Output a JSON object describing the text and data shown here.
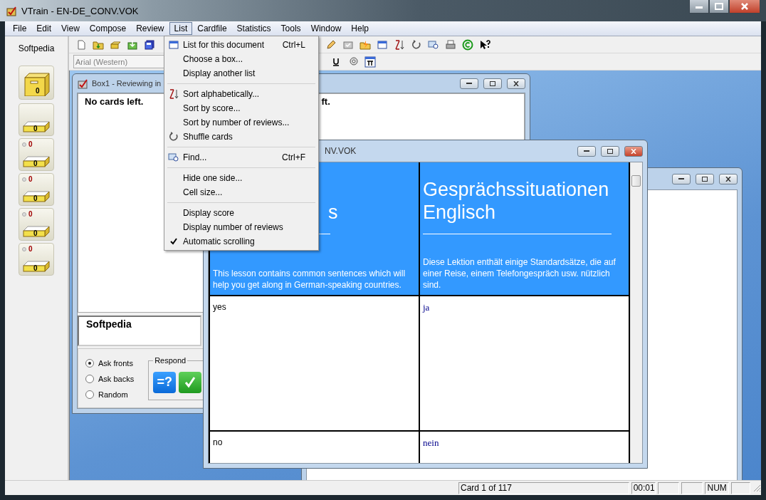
{
  "window": {
    "title": "VTrain - EN-DE_CONV.VOK"
  },
  "menu_bar": [
    {
      "label": "File",
      "selected": false
    },
    {
      "label": "Edit",
      "selected": false
    },
    {
      "label": "View",
      "selected": false
    },
    {
      "label": "Compose",
      "selected": false
    },
    {
      "label": "Review",
      "selected": false
    },
    {
      "label": "List",
      "selected": true
    },
    {
      "label": "Cardfile",
      "selected": false
    },
    {
      "label": "Statistics",
      "selected": false
    },
    {
      "label": "Tools",
      "selected": false
    },
    {
      "label": "Window",
      "selected": false
    },
    {
      "label": "Help",
      "selected": false
    }
  ],
  "sidebar": {
    "label": "Softpedia",
    "boxes": [
      {
        "kind": "drawer",
        "count": "0"
      },
      {
        "kind": "tray",
        "count": "0"
      },
      {
        "kind": "tray",
        "count": "0",
        "due": "0"
      },
      {
        "kind": "tray",
        "count": "0",
        "due": "0"
      },
      {
        "kind": "tray",
        "count": "0",
        "due": "0"
      },
      {
        "kind": "tray",
        "count": "0",
        "due": "0"
      }
    ]
  },
  "toolbar": {
    "font_field": {
      "value": "Arial (Western)",
      "disabled": true
    }
  },
  "box_window": {
    "title": "Box1 - Reviewing in",
    "panes": [
      "No cards left.",
      "ft."
    ],
    "answer": "Softpedia",
    "ask_options": [
      {
        "label": "Ask fronts",
        "selected": true
      },
      {
        "label": "Ask backs",
        "selected": false
      },
      {
        "label": "Random",
        "selected": false
      }
    ],
    "respond": {
      "label": "Respond",
      "show_button": "=?"
    }
  },
  "list_window": {
    "title": "NV.VOK",
    "header": [
      {
        "title": "s",
        "description": "This lesson contains common sentences which will help you get along in German-speaking countries."
      },
      {
        "title": "Gesprächssituationen Englisch",
        "description": "Diese Lektion enthält einige Standardsätze, die auf einer Reise, einem Telefongespräch usw. nützlich sind."
      }
    ],
    "rows": [
      [
        "yes",
        "ja"
      ],
      [
        "no",
        "nein"
      ]
    ]
  },
  "list_menu": [
    {
      "kind": "item",
      "label": "List for this document",
      "shortcut": "Ctrl+L"
    },
    {
      "kind": "item",
      "label": "Choose a box..."
    },
    {
      "kind": "item",
      "label": "Display another list"
    },
    {
      "kind": "separator"
    },
    {
      "kind": "item",
      "label": "Sort alphabetically..."
    },
    {
      "kind": "item",
      "label": "Sort by score..."
    },
    {
      "kind": "item",
      "label": "Sort by number of reviews..."
    },
    {
      "kind": "item",
      "label": "Shuffle cards"
    },
    {
      "kind": "separator"
    },
    {
      "kind": "item",
      "label": "Find...",
      "shortcut": "Ctrl+F"
    },
    {
      "kind": "separator"
    },
    {
      "kind": "item",
      "label": "Hide one side..."
    },
    {
      "kind": "item",
      "label": "Cell size..."
    },
    {
      "kind": "separator"
    },
    {
      "kind": "toggle",
      "label": "Display score",
      "checked": false
    },
    {
      "kind": "toggle",
      "label": "Display number of reviews",
      "checked": false
    },
    {
      "kind": "toggle",
      "label": "Automatic scrolling",
      "checked": true
    }
  ],
  "status_bar": {
    "card": "Card 1 of 117",
    "time": "00:01",
    "num": "NUM"
  }
}
